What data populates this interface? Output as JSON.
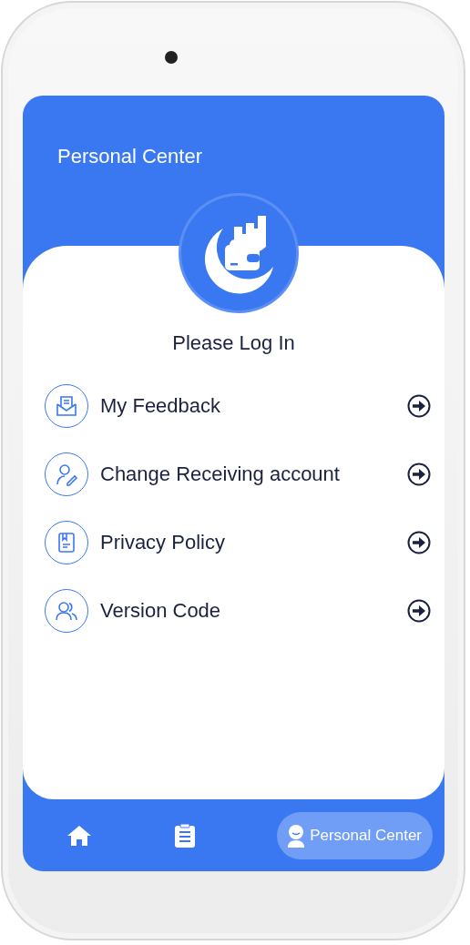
{
  "header": {
    "title": "Personal Center"
  },
  "profile": {
    "caption": "Please Log In"
  },
  "menu": [
    {
      "kind": "feedback",
      "label": "My Feedback"
    },
    {
      "kind": "account",
      "label": "Change Receiving account"
    },
    {
      "kind": "privacy",
      "label": "Privacy Policy"
    },
    {
      "kind": "version",
      "label": "Version Code"
    }
  ],
  "tabs": [
    {
      "kind": "home",
      "selected": false
    },
    {
      "kind": "list",
      "selected": false
    },
    {
      "kind": "person",
      "label": "Personal Center",
      "selected": true
    }
  ]
}
